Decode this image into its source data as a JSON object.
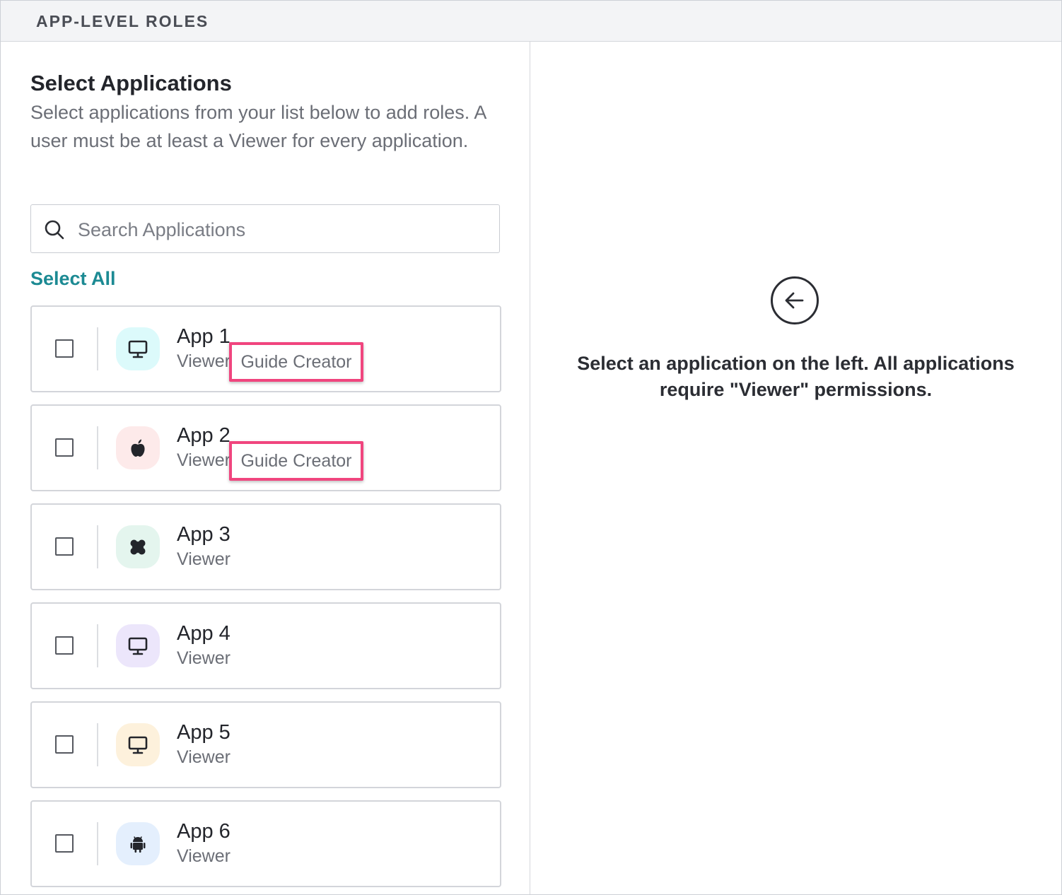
{
  "header": {
    "title": "APP-LEVEL ROLES"
  },
  "left": {
    "title": "Select Applications",
    "description": "Select applications from your list below to add roles. A user must be at least a Viewer for every application.",
    "search": {
      "placeholder": "Search Applications",
      "value": ""
    },
    "select_all_label": "Select All",
    "apps": [
      {
        "name": "App 1",
        "role": "Viewer",
        "extra_role": "Guide Creator",
        "icon": "desktop-icon",
        "icon_bg": "#dcfafb"
      },
      {
        "name": "App 2",
        "role": "Viewer",
        "extra_role": "Guide Creator",
        "icon": "apple-icon",
        "icon_bg": "#fdeaea"
      },
      {
        "name": "App 3",
        "role": "Viewer",
        "icon": "puzzle-icon",
        "icon_bg": "#e4f5ee"
      },
      {
        "name": "App 4",
        "role": "Viewer",
        "icon": "desktop-icon",
        "icon_bg": "#ece6fb"
      },
      {
        "name": "App 5",
        "role": "Viewer",
        "icon": "desktop-icon",
        "icon_bg": "#fdf1dc"
      },
      {
        "name": "App 6",
        "role": "Viewer",
        "icon": "android-icon",
        "icon_bg": "#e4effd"
      }
    ]
  },
  "right": {
    "back_icon": "arrow-left-circle-icon",
    "message": "Select an application on the left. All applications require \"Viewer\" permissions."
  },
  "colors": {
    "accent": "#1c8a93",
    "highlight_border": "#f0457e"
  }
}
